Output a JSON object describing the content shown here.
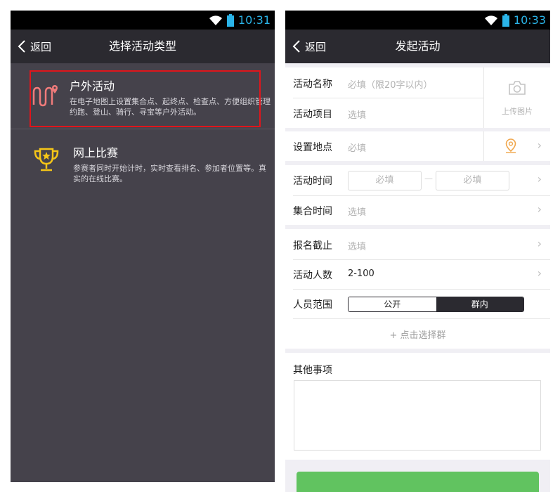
{
  "left": {
    "status_time": "10:31",
    "back_label": "返回",
    "title": "选择活动类型",
    "items": [
      {
        "name": "户外活动",
        "desc": "在电子地图上设置集合点、起终点、检查点、方便组织管理约跑、登山、骑行、寻宝等户外活动。",
        "icon": "route-pin-icon"
      },
      {
        "name": "网上比赛",
        "desc": "参赛者同时开始计时，实时查看排名、参加者位置等。真实的在线比赛。",
        "icon": "trophy-icon"
      }
    ]
  },
  "right": {
    "status_time": "10:33",
    "back_label": "返回",
    "title": "发起活动",
    "name_label": "活动名称",
    "name_placeholder": "必填（限20字以内）",
    "project_label": "活动项目",
    "project_placeholder": "选填",
    "upload_label": "上传图片",
    "location_label": "设置地点",
    "location_placeholder": "必填",
    "time_label": "活动时间",
    "time_start_placeholder": "必填",
    "time_dash": "—",
    "time_end_placeholder": "必填",
    "gather_label": "集合时间",
    "gather_placeholder": "选填",
    "deadline_label": "报名截止",
    "deadline_placeholder": "选填",
    "count_label": "活动人数",
    "count_value": "2-100",
    "scope_label": "人员范围",
    "scope_options": [
      "公开",
      "群内"
    ],
    "scope_selected": "群内",
    "pick_group": "+ 点击选择群",
    "other_label": "其他事项"
  },
  "colors": {
    "accent_blue": "#2ab4e8",
    "dark_bar": "#2b2a30",
    "list_bg": "#45424b",
    "highlight_red": "#e0151b",
    "submit_green": "#61c360",
    "icon_orange": "#f0a64b",
    "icon_pink": "#f07b7b",
    "trophy_yellow": "#f5c518"
  }
}
